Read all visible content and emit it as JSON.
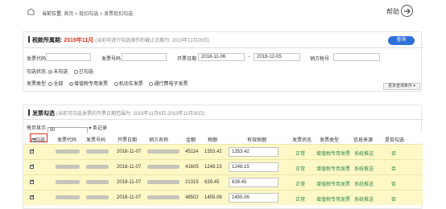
{
  "header": {
    "location_label": "当前位置:",
    "breadcrumb": [
      "首页",
      "批扣勾选",
      "发票批扣勾选"
    ],
    "separator": ">",
    "help_label": "帮助"
  },
  "period": {
    "title": "税款所属期:",
    "value": "2019年11月",
    "note": "(当前可进行勾选操作的截止日期为: 2019年12月20日)",
    "query_button": "查询"
  },
  "filters": {
    "invoice_code_label": "发票代码",
    "invoice_code_value": "",
    "invoice_number_label": "发票号码",
    "invoice_number_value": "",
    "issue_date_label": "开票日期",
    "date_from": "2018-11-06",
    "date_to": "2018-12-05",
    "date_sep": "-",
    "seller_tax_label": "销方税号",
    "seller_tax_value": "",
    "check_status_label": "勾选状态:",
    "check_status_options": [
      "未勾选",
      "已勾选"
    ],
    "invoice_type_label": "发票类型:",
    "invoice_type_options": [
      "全部",
      "增值税专用发票",
      "机动车发票",
      "通行费电子发票"
    ],
    "more_conditions": "更多查询条件 ▾"
  },
  "list": {
    "title": "发票勾选",
    "note": "(当前可勾选发票的开票日期范围为: 2018年11月6日-2019年11月30日)",
    "per_page_label": "每页显示",
    "per_page_value": "50",
    "per_page_suffix": "条记录",
    "headers": {
      "check": "勾选",
      "code": "发票代码",
      "number": "发票号码",
      "date": "开票日期",
      "seller": "销方名称",
      "amount": "金额",
      "tax": "税额",
      "valid_tax": "有效税额",
      "status": "发票状态",
      "type": "发票类型",
      "source": "信息来源",
      "checked": "是否勾选"
    },
    "rows": [
      {
        "date": "2018-11-07",
        "amount": "45114",
        "tax": "1353.42",
        "valid_tax": "1353.42",
        "status": "正常",
        "type": "增值税专用发票",
        "source": "系统推送",
        "checked": "否"
      },
      {
        "date": "2018-11-07",
        "amount": "41605",
        "tax": "1248.15",
        "valid_tax": "1248.15",
        "status": "正常",
        "type": "增值税专用发票",
        "source": "系统推送",
        "checked": "否"
      },
      {
        "date": "2018-11-07",
        "amount": "21315",
        "tax": "639.45",
        "valid_tax": "639.45",
        "status": "正常",
        "type": "增值税专用发票",
        "source": "系统推送",
        "checked": "否"
      },
      {
        "date": "2018-11-07",
        "amount": "48502",
        "tax": "1455.06",
        "valid_tax": "1455.06",
        "status": "正常",
        "type": "增值税专用发票",
        "source": "系统推送",
        "checked": "否"
      }
    ]
  }
}
